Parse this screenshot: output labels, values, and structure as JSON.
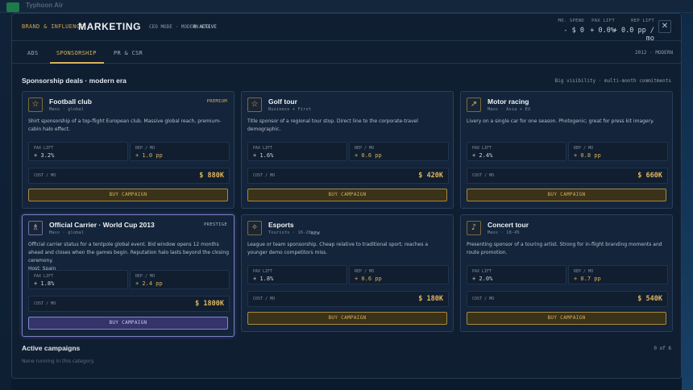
{
  "background": {
    "company_name": "Typhoon Air"
  },
  "header": {
    "breadcrumb": "BRAND & INFLUENCE",
    "title": "MARKETING",
    "mode": "CEO MODE · MODERN ERA",
    "active": "0 ACTIVE",
    "stats": [
      {
        "label": "MO. SPEND",
        "value": "- $ 0"
      },
      {
        "label": "PAX LIFT",
        "value": "+ 0.0%"
      },
      {
        "label": "REP LIFT",
        "value": "+ 0.0 pp / mo"
      }
    ],
    "close": "✕"
  },
  "tabs": [
    {
      "label": "ADS"
    },
    {
      "label": "SPONSORSHIP"
    },
    {
      "label": "PR & CSR"
    }
  ],
  "era": "2012 · MODERN",
  "section": {
    "title": "Sponsorship deals · modern era",
    "note": "Big visibility · multi-month commitments"
  },
  "cards": [
    {
      "icon": "☆",
      "name": "Football club",
      "tag": "Mass · global",
      "badge": "PREMIUM",
      "desc": "Shirt sponsorship of a top-flight European club. Massive global reach, premium-cabin halo effect.",
      "pax_label": "PAX LIFT",
      "pax": "+ 3.2%",
      "rep_label": "REP / MO",
      "rep": "+ 1.0 pp",
      "cost_label": "COST / MO",
      "cost": "$ 880K",
      "buy": "BUY CAMPAIGN"
    },
    {
      "icon": "☆",
      "name": "Golf tour",
      "tag": "Business + First",
      "badge": "",
      "desc": "Title sponsor of a regional tour stop. Direct line to the corporate-travel demographic.",
      "pax_label": "PAX LIFT",
      "pax": "+ 1.6%",
      "rep_label": "REP / MO",
      "rep": "+ 0.6 pp",
      "cost_label": "COST / MO",
      "cost": "$ 420K",
      "buy": "BUY CAMPAIGN"
    },
    {
      "icon": "↗",
      "name": "Motor racing",
      "tag": "Mass · Asia + EU",
      "badge": "",
      "desc": "Livery on a single car for one season. Photogenic; great for press kit imagery.",
      "pax_label": "PAX LIFT",
      "pax": "+ 2.4%",
      "rep_label": "REP / MO",
      "rep": "+ 0.8 pp",
      "cost_label": "COST / MO",
      "cost": "$ 660K",
      "buy": "BUY CAMPAIGN"
    },
    {
      "icon": "♗",
      "name": "Official Carrier · World Cup 2013",
      "tag": "Mass · global",
      "badge": "PRESTIGE",
      "desc": "Official carrier status for a tentpole global event. Bid window opens 12 months ahead and closes when the games begin. Reputation halo lasts beyond the closing ceremony.",
      "host": "Host: Spain",
      "pax_label": "PAX LIFT",
      "pax": "+ 1.8%",
      "rep_label": "REP / MO",
      "rep": "+ 2.4 pp",
      "cost_label": "COST / MO",
      "cost": "$ 1800K",
      "buy": "BUY CAMPAIGN"
    },
    {
      "icon": "✧",
      "name": "Esports",
      "tag": "Tourists · 16-28",
      "badge": "NEW",
      "desc": "League or team sponsorship. Cheap relative to traditional sport; reaches a younger demo competitors miss.",
      "pax_label": "PAX LIFT",
      "pax": "+ 1.8%",
      "rep_label": "REP / MO",
      "rep": "+ 0.6 pp",
      "cost_label": "COST / MO",
      "cost": "$ 180K",
      "buy": "BUY CAMPAIGN"
    },
    {
      "icon": "♪",
      "name": "Concert tour",
      "tag": "Mass · 18-45",
      "badge": "",
      "desc": "Presenting sponsor of a touring artist. Strong for in-flight branding moments and route promotion.",
      "pax_label": "PAX LIFT",
      "pax": "+ 2.0%",
      "rep_label": "REP / MO",
      "rep": "+ 0.7 pp",
      "cost_label": "COST / MO",
      "cost": "$ 540K",
      "buy": "BUY CAMPAIGN"
    }
  ],
  "active_campaigns": {
    "title": "Active campaigns",
    "count": "0 of 6",
    "empty": "None running in this category."
  },
  "colors": {
    "accent_gold": "#d9b15c",
    "prestige_purple": "#8585cc",
    "panel_bg": "#0f1e31"
  }
}
